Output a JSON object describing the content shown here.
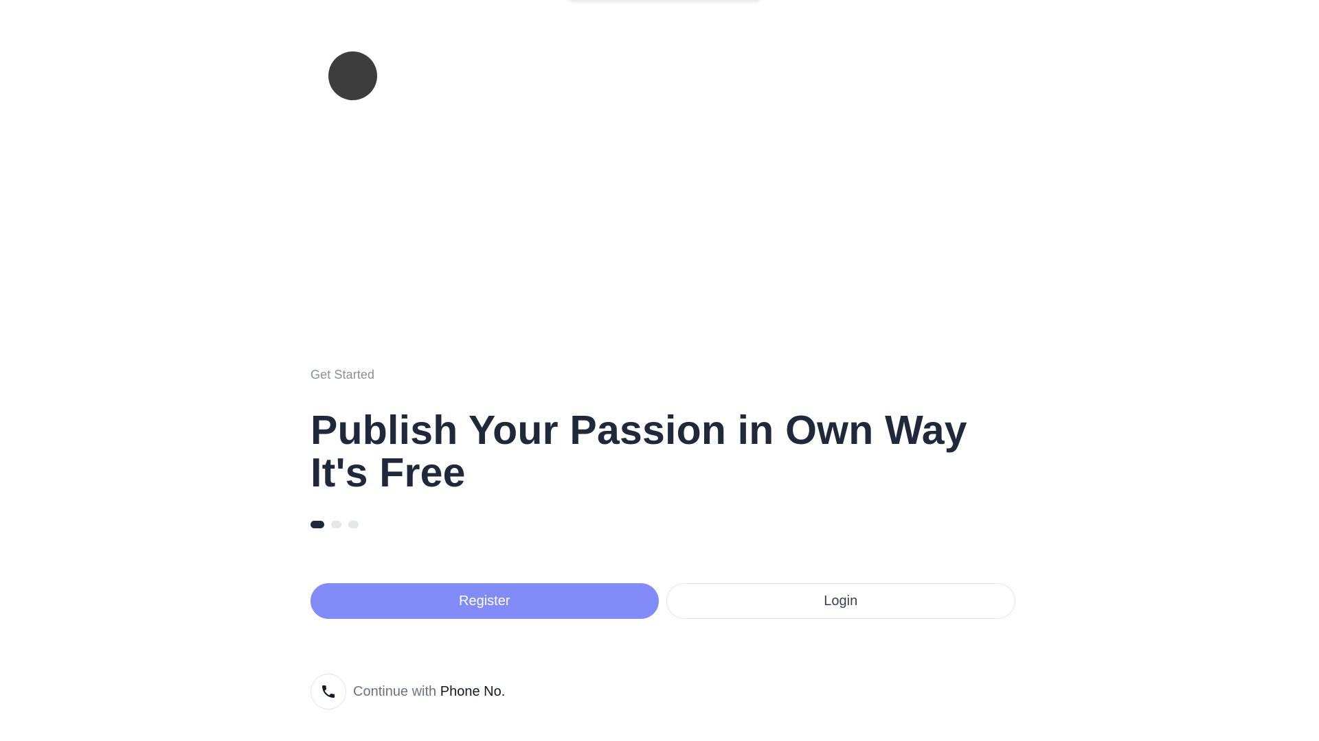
{
  "eyebrow": "Get Started",
  "headline": {
    "line1": "Publish Your Passion in Own Way",
    "line2": "It's Free"
  },
  "carousel": {
    "total": 3,
    "active_index": 0
  },
  "buttons": {
    "register": "Register",
    "login": "Login"
  },
  "phone": {
    "prefix": "Continue with",
    "label": "Phone No.",
    "icon": "phone-icon"
  },
  "colors": {
    "primary": "#818cf8",
    "heading": "#1e293b",
    "muted": "#8a8f98"
  }
}
